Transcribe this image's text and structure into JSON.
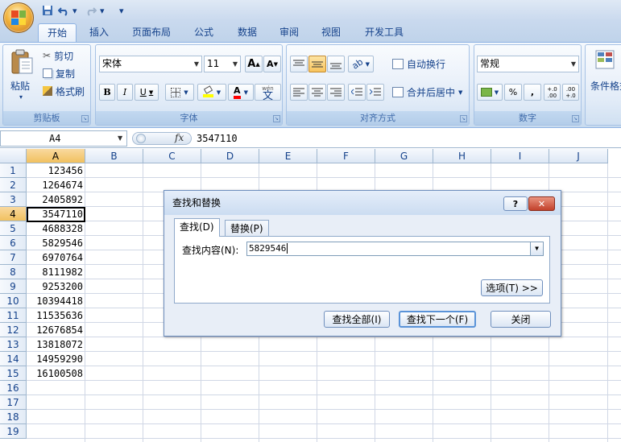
{
  "quick_access": {
    "undo_dropdown": "▾",
    "redo_dropdown": "▾",
    "customize": "▾"
  },
  "tabs": [
    {
      "label": "开始",
      "active": true
    },
    {
      "label": "插入"
    },
    {
      "label": "页面布局"
    },
    {
      "label": "公式"
    },
    {
      "label": "数据"
    },
    {
      "label": "审阅"
    },
    {
      "label": "视图"
    },
    {
      "label": "开发工具"
    }
  ],
  "clipboard": {
    "paste": "粘贴",
    "cut": "剪切",
    "copy": "复制",
    "format_painter": "格式刷",
    "group": "剪贴板"
  },
  "font": {
    "name": "宋体",
    "size": "11",
    "grow": "A",
    "shrink": "A",
    "bold": "B",
    "italic": "I",
    "underline": "U",
    "font_color_letter": "A",
    "wen_pinyin": "wén",
    "wen_char": "文",
    "group": "字体"
  },
  "alignment": {
    "wrap_text": "自动换行",
    "merge_center": "合并后居中",
    "group": "对齐方式"
  },
  "number": {
    "format": "常规",
    "percent": "%",
    "comma": ",",
    "inc_decimal": "+.0 .00",
    "dec_decimal": ".00 +.0",
    "group": "数字"
  },
  "styles": {
    "conditional": "条件格式"
  },
  "formula_bar": {
    "name_box": "A4",
    "fx": "fx",
    "value": "3547110"
  },
  "columns": [
    "A",
    "B",
    "C",
    "D",
    "E",
    "F",
    "G",
    "H",
    "I",
    "J"
  ],
  "rows": [
    "1",
    "2",
    "3",
    "4",
    "5",
    "6",
    "7",
    "8",
    "9",
    "10",
    "11",
    "12",
    "13",
    "14",
    "15",
    "16",
    "17",
    "18",
    "19"
  ],
  "cells_A": [
    "123456",
    "1264674",
    "2405892",
    "3547110",
    "4688328",
    "5829546",
    "6970764",
    "8111982",
    "9253200",
    "10394418",
    "11535636",
    "12676854",
    "13818072",
    "14959290",
    "16100508"
  ],
  "active_cell": "A4",
  "dialog": {
    "title": "查找和替换",
    "help": "?",
    "close_x": "✕",
    "tab_find": "查找(D)",
    "tab_replace": "替换(P)",
    "find_label": "查找内容(N):",
    "find_value": "5829546",
    "options": "选项(T) >>",
    "find_all": "查找全部(I)",
    "find_next": "查找下一个(F)",
    "close": "关闭"
  },
  "colors": {
    "accent": "#15428b",
    "ribbon": "#dbe7f5",
    "selected_header": "#f1c15f"
  }
}
